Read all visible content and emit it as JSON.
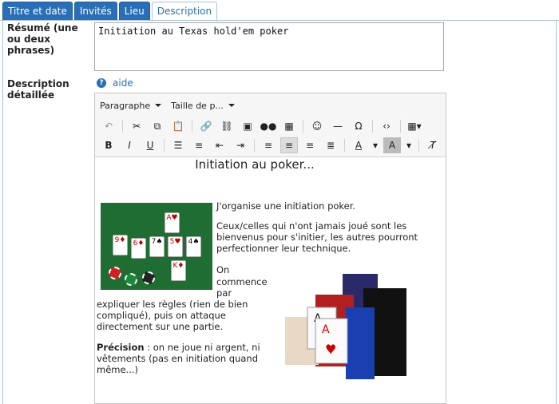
{
  "tabs": [
    "Titre et date",
    "Invités",
    "Lieu",
    "Description"
  ],
  "form": {
    "resume_label": "Résumé (une ou deux phrases)",
    "resume_value": "Initiation au Texas hold'em poker",
    "description_label": "Description détaillée",
    "help_label": "aide"
  },
  "toolbar": {
    "format_select": "Paragraphe",
    "size_select": "Taille de p..."
  },
  "doc": {
    "title": "Initiation au poker...",
    "para1": "J'organise une initiation poker.",
    "para2": "Ceux/celles qui n'ont jamais joué sont les bienvenus pour s'initier, les autres pourront perfectionner leur technique.",
    "para3_line1": "On",
    "para3_line2": "commence",
    "para3_line3": "par",
    "para3_rest": "expliquer les règles (rien de bien compliqué), puis on attaque directement sur une partie.",
    "precision_label": "Précision",
    "precision_text": " : on ne joue ni argent, ni vêtements  (pas en initiation quand même...)"
  },
  "colors": {
    "tab_blue": "#2a6fb5",
    "felt_green": "#1f6d33"
  }
}
